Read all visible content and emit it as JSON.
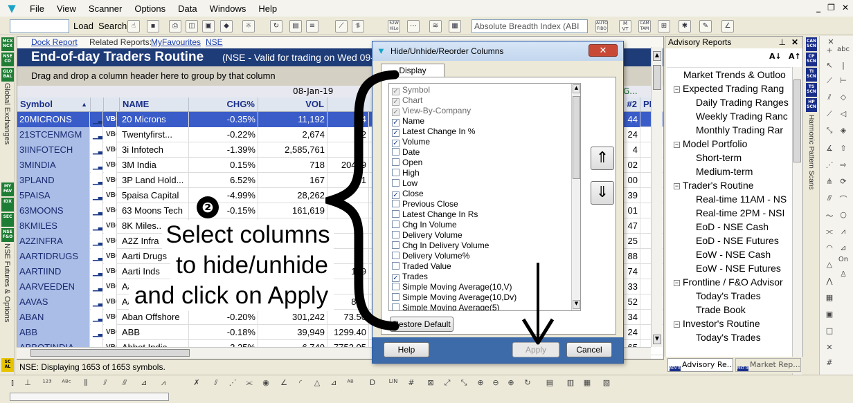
{
  "menu": {
    "items": [
      "File",
      "View",
      "Scanner",
      "Options",
      "Data",
      "Windows",
      "Help"
    ],
    "window_controls": [
      "_",
      "❐",
      "✕"
    ]
  },
  "toolbar": {
    "load_label": "Load",
    "search_label": "Search",
    "indicator_value": "Absolute Breadth Index (ABI",
    "icons": [
      "pointer-icon",
      "save-icon",
      "print-icon",
      "preview-icon",
      "scan-icon",
      "chart-icon",
      "network-icon",
      "refresh-icon",
      "table-icon",
      "lines-icon",
      "line-chart-icon",
      "trend-icon",
      "52wk-hilo-icon",
      "more-icon",
      "bands-icon",
      "filter-icon",
      "auto-fibo-icon",
      "move-icon",
      "cam-icon",
      "gann-icon",
      "zoom-icon",
      "tools-icon",
      "angle-icon"
    ],
    "icon_text": {
      "52wk": "52W HiLo",
      "autofibo": "AUTO FIBO",
      "mavt": "M VT",
      "cam": "CAM TAM"
    }
  },
  "left_strip": {
    "badges": [
      "MCX NCX",
      "NSE CD",
      "GLO BAL",
      "MY FAV",
      "IDX",
      "SEC",
      "NSE F&O"
    ],
    "labels": [
      "Global Exchanges",
      "NSE Futures & Options"
    ],
    "bottom_badge": "SC AL"
  },
  "report": {
    "dock_report": "Dock Report",
    "related_reports": "Related Reports:",
    "my_favourites": "MyFavourites",
    "nse": "NSE",
    "title": "End-of-day Traders Routine",
    "subtitle": "(NSE  -  Valid for trading on Wed 09-",
    "group_hint": "Drag and drop a column header here to group by that column",
    "date_header": "08-Jan-19",
    "right_header": "NG...",
    "columns": [
      "Symbol",
      "NAME",
      "CHG%",
      "VOL",
      "#2",
      "PE"
    ],
    "rows": [
      {
        "symbol": "20MICRONS",
        "name": "20 Microns",
        "chg": "-0.35%",
        "vol": "11,192",
        "x": "4",
        "r": "44"
      },
      {
        "symbol": "21STCENMGM",
        "name": "Twentyfirst...",
        "chg": "-0.22%",
        "vol": "2,674",
        "x": "2",
        "r": "24"
      },
      {
        "symbol": "3IINFOTECH",
        "name": "3i Infotech",
        "chg": "-1.39%",
        "vol": "2,585,761",
        "x": "",
        "r": "4"
      },
      {
        "symbol": "3MINDIA",
        "name": "3M India",
        "chg": "0.15%",
        "vol": "718",
        "x": "20419",
        "r": "02"
      },
      {
        "symbol": "3PLAND",
        "name": "3P Land Hold...",
        "chg": "6.52%",
        "vol": "167",
        "x": "1",
        "r": "00"
      },
      {
        "symbol": "5PAISA",
        "name": "5paisa Capital",
        "chg": "-4.99%",
        "vol": "28,262",
        "x": "",
        "r": "39"
      },
      {
        "symbol": "63MOONS",
        "name": "63 Moons Tech",
        "chg": "-0.15%",
        "vol": "161,619",
        "x": "",
        "r": "01"
      },
      {
        "symbol": "8KMILES",
        "name": "8K Miles...",
        "chg": "",
        "vol": "",
        "x": "",
        "r": "47"
      },
      {
        "symbol": "A2ZINFRA",
        "name": "A2Z Infra",
        "chg": "",
        "vol": "",
        "x": "",
        "r": "25"
      },
      {
        "symbol": "AARTIDRUGS",
        "name": "Aarti Drugs",
        "chg": "",
        "vol": "",
        "x": "",
        "r": "88"
      },
      {
        "symbol": "AARTIIND",
        "name": "Aarti Inds",
        "chg": "",
        "vol": "",
        "x": "149",
        "r": "74"
      },
      {
        "symbol": "AARVEEDEN",
        "name": "Aa",
        "chg": "",
        "vol": "",
        "x": "",
        "r": "33"
      },
      {
        "symbol": "AAVAS",
        "name": "Aa",
        "chg": "",
        "vol": "",
        "x": "841",
        "r": "52"
      },
      {
        "symbol": "ABAN",
        "name": "Aban Offshore",
        "chg": "-0.20%",
        "vol": "301,242",
        "x": "73.50",
        "r": "34"
      },
      {
        "symbol": "ABB",
        "name": "ABB",
        "chg": "-0.18%",
        "vol": "39,949",
        "x": "1299.40",
        "r": "24"
      },
      {
        "symbol": "ABBOTINDIA",
        "name": "Abbot India",
        "chg": "2.25%",
        "vol": "6,740",
        "x": "7752.05",
        "r": "65"
      }
    ],
    "status": "NSE: Displaying 1653 of 1653 symbols."
  },
  "advisory": {
    "title": "Advisory Reports",
    "sort_az": "A↓",
    "sort_za": "A↑",
    "tree": [
      {
        "label": "Market Trends & Outloo",
        "level": 0,
        "pm": ""
      },
      {
        "label": "Expected Trading Rang",
        "level": 0,
        "pm": "−"
      },
      {
        "label": "Daily Trading Ranges",
        "level": 1,
        "pm": ""
      },
      {
        "label": "Weekly Trading Ranc",
        "level": 1,
        "pm": ""
      },
      {
        "label": "Monthly Trading Rar",
        "level": 1,
        "pm": ""
      },
      {
        "label": "Model Portfolio",
        "level": 0,
        "pm": "−"
      },
      {
        "label": "Short-term",
        "level": 1,
        "pm": ""
      },
      {
        "label": "Medium-term",
        "level": 1,
        "pm": ""
      },
      {
        "label": "Trader's Routine",
        "level": 0,
        "pm": "−"
      },
      {
        "label": "Real-time 11AM - NS",
        "level": 1,
        "pm": ""
      },
      {
        "label": "Real-time 2PM - NSI",
        "level": 1,
        "pm": ""
      },
      {
        "label": "EoD - NSE Cash",
        "level": 1,
        "pm": ""
      },
      {
        "label": "EoD - NSE Futures",
        "level": 1,
        "pm": ""
      },
      {
        "label": "EoW - NSE Cash",
        "level": 1,
        "pm": ""
      },
      {
        "label": "EoW - NSE Futures",
        "level": 1,
        "pm": ""
      },
      {
        "label": "Frontline / F&O Advisor",
        "level": 0,
        "pm": "−"
      },
      {
        "label": "Today's Trades",
        "level": 1,
        "pm": ""
      },
      {
        "label": "Trade Book",
        "level": 1,
        "pm": ""
      },
      {
        "label": "Investor's Routine",
        "level": 0,
        "pm": "−"
      },
      {
        "label": "Today's Trades",
        "level": 1,
        "pm": ""
      }
    ],
    "tabs": [
      {
        "badge": "ADV REP",
        "label": "Advisory Re..."
      },
      {
        "badge": "MKT REP",
        "label": "Market Rep..."
      }
    ]
  },
  "right_strip": {
    "badges": [
      "CAN SCN",
      "CP SCN",
      "TI SCN",
      "TS SCN",
      "HP SCN"
    ],
    "label": "Harmonic Pattern Scans",
    "tool_text": {
      "abc": "abc",
      "on": "On"
    }
  },
  "dialog": {
    "title": "Hide/Unhide/Reorder Columns",
    "tab": "Display Columns",
    "columns": [
      {
        "label": "Symbol",
        "checked": true,
        "disabled": true
      },
      {
        "label": "Chart",
        "checked": true,
        "disabled": true
      },
      {
        "label": "View-By-Company",
        "checked": true,
        "disabled": true
      },
      {
        "label": "Name",
        "checked": true,
        "disabled": false
      },
      {
        "label": "Latest Change In %",
        "checked": true,
        "disabled": false
      },
      {
        "label": "Volume",
        "checked": true,
        "disabled": false
      },
      {
        "label": "Date",
        "checked": false,
        "disabled": false
      },
      {
        "label": "Open",
        "checked": false,
        "disabled": false
      },
      {
        "label": "High",
        "checked": false,
        "disabled": false
      },
      {
        "label": "Low",
        "checked": false,
        "disabled": false
      },
      {
        "label": "Close",
        "checked": true,
        "disabled": false
      },
      {
        "label": "Previous Close",
        "checked": false,
        "disabled": false
      },
      {
        "label": "Latest Change In Rs",
        "checked": false,
        "disabled": false
      },
      {
        "label": "Chg In Volume",
        "checked": false,
        "disabled": false
      },
      {
        "label": "Delivery Volume",
        "checked": false,
        "disabled": false
      },
      {
        "label": "Chg In Delivery Volume",
        "checked": false,
        "disabled": false
      },
      {
        "label": "Delivery Volume%",
        "checked": false,
        "disabled": false
      },
      {
        "label": "Traded Value",
        "checked": false,
        "disabled": false
      },
      {
        "label": "Trades",
        "checked": true,
        "disabled": false
      },
      {
        "label": "Simple Moving Average(10,V)",
        "checked": false,
        "disabled": false
      },
      {
        "label": "Simple Moving Average(10,Dv)",
        "checked": false,
        "disabled": false
      },
      {
        "label": "Simple Moving Average(5)",
        "checked": false,
        "disabled": false
      }
    ],
    "restore_default": "Restore Default",
    "help": "Help",
    "apply": "Apply",
    "cancel": "Cancel"
  },
  "annotation": {
    "step": "❷",
    "lines": [
      "Select columns",
      "to hide/unhide",
      "and click on Apply"
    ]
  },
  "colors": {
    "title_bg": "#1e3c78",
    "selected_row": "#3a5cc8",
    "symbol_cell": "#a9bde6",
    "badge_green": "#1e7d34",
    "badge_blue": "#1a2f8a",
    "dialog_footer": "#3d6aa8",
    "close_button": "#c84a36"
  }
}
